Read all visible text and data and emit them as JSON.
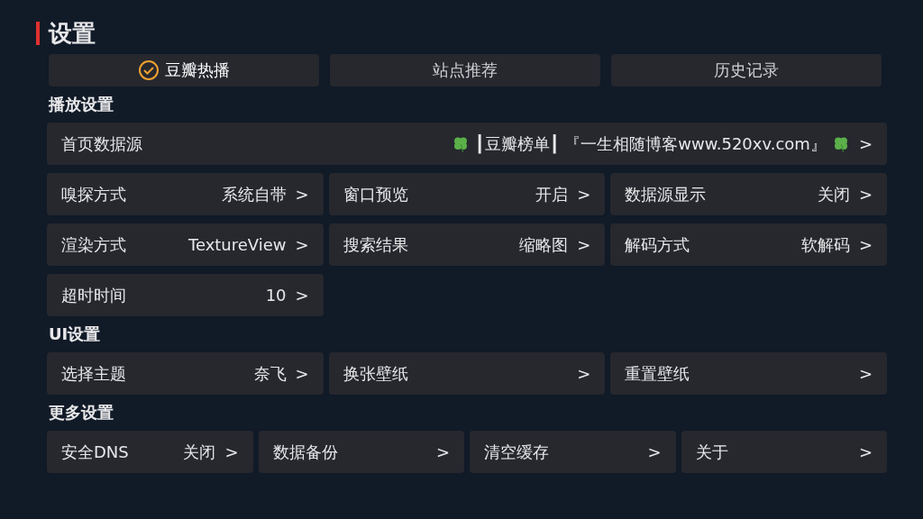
{
  "title": "设置",
  "top_tabs": [
    {
      "label": "豆瓣热播",
      "selected": true
    },
    {
      "label": "站点推荐",
      "selected": false
    },
    {
      "label": "历史记录",
      "selected": false
    }
  ],
  "sections": [
    {
      "title": "播放设置",
      "items": [
        {
          "kind": "wide",
          "label": "首页数据源",
          "value": "┃豆瓣榜单┃ 『一生相随博客www.520xv.com』",
          "clover": true,
          "chevron": ">"
        },
        {
          "kind": "normal",
          "label": "嗅探方式",
          "value": "系统自带",
          "chevron": ">"
        },
        {
          "kind": "normal",
          "label": "窗口预览",
          "value": "开启",
          "chevron": ">"
        },
        {
          "kind": "normal",
          "label": "数据源显示",
          "value": "关闭",
          "chevron": ">"
        },
        {
          "kind": "normal",
          "label": "渲染方式",
          "value": "TextureView",
          "chevron": ">"
        },
        {
          "kind": "normal",
          "label": "搜索结果",
          "value": "缩略图",
          "chevron": ">"
        },
        {
          "kind": "normal",
          "label": "解码方式",
          "value": "软解码",
          "chevron": ">"
        },
        {
          "kind": "normal",
          "label": "超时时间",
          "value": "10",
          "chevron": ">"
        }
      ]
    },
    {
      "title": "UI设置",
      "items": [
        {
          "kind": "normal",
          "label": "选择主题",
          "value": "奈飞",
          "chevron": ">"
        },
        {
          "kind": "normal",
          "label": "换张壁纸",
          "chevron": ">"
        },
        {
          "kind": "normal",
          "label": "重置壁纸",
          "chevron": ">"
        }
      ]
    },
    {
      "title": "更多设置",
      "items": [
        {
          "kind": "normal",
          "label": "安全DNS",
          "value": "关闭",
          "chevron": ">"
        },
        {
          "kind": "normal",
          "label": "数据备份",
          "chevron": ">"
        },
        {
          "kind": "normal",
          "label": "清空缓存",
          "chevron": ">"
        },
        {
          "kind": "normal",
          "label": "关于",
          "chevron": ">"
        }
      ]
    }
  ]
}
